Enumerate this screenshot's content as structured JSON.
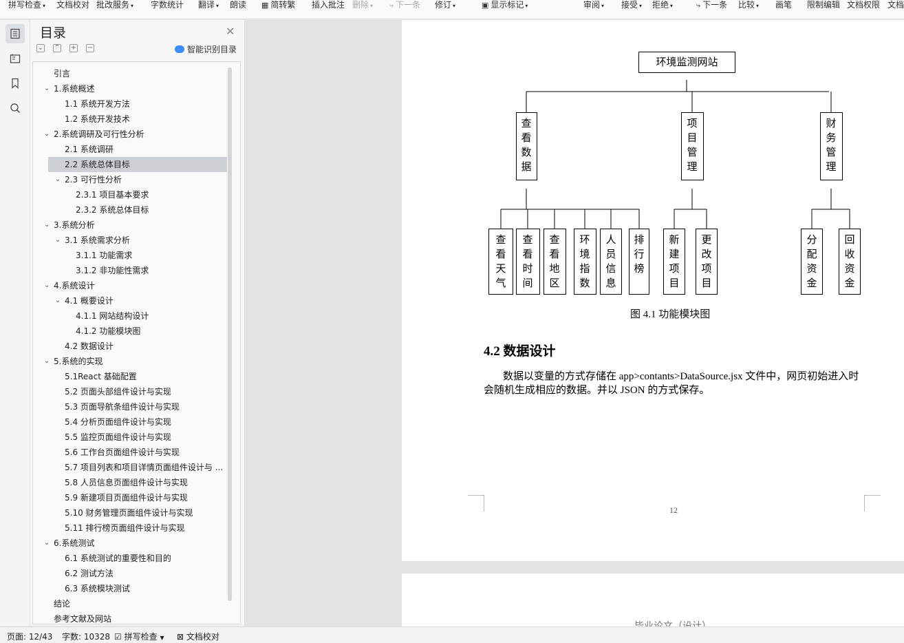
{
  "toolbar": {
    "items": [
      {
        "label": "拼写检查",
        "caret": true
      },
      {
        "label": "文档校对",
        "caret": false
      },
      {
        "label": "批改服务",
        "caret": true
      },
      {
        "label": "字数统计",
        "caret": false
      },
      {
        "label": "翻译",
        "caret": true
      },
      {
        "label": "朗读",
        "caret": false
      },
      {
        "label": "简转繁",
        "caret": false
      },
      {
        "label": "插入批注",
        "caret": false
      },
      {
        "label": "删除",
        "caret": true
      },
      {
        "label": "下一条",
        "caret": false
      },
      {
        "label": "修订",
        "caret": true
      },
      {
        "label": "显示标记",
        "caret": true
      },
      {
        "label": "审阅",
        "caret": true
      },
      {
        "label": "接受",
        "caret": true
      },
      {
        "label": "拒绝",
        "caret": true
      },
      {
        "label": "下一条",
        "caret": false
      },
      {
        "label": "比较",
        "caret": true
      },
      {
        "label": "画笔",
        "caret": false
      },
      {
        "label": "限制编辑",
        "caret": false
      },
      {
        "label": "文档权限",
        "caret": false
      },
      {
        "label": "文档",
        "caret": false
      }
    ]
  },
  "toc": {
    "title": "目录",
    "ai_label": "智能识别目录",
    "controls": [
      "⌄",
      "⌃",
      "+",
      "−"
    ],
    "items": [
      {
        "label": "引言",
        "level": 0,
        "chev": false
      },
      {
        "label": "1.系统概述",
        "level": 0,
        "chev": true
      },
      {
        "label": "1.1  系统开发方法",
        "level": 1,
        "chev": false
      },
      {
        "label": "1.2  系统开发技术",
        "level": 1,
        "chev": false
      },
      {
        "label": "2.系统调研及可行性分析",
        "level": 0,
        "chev": true
      },
      {
        "label": "2.1 系统调研",
        "level": 1,
        "chev": false
      },
      {
        "label": "2.2 系统总体目标",
        "level": 1,
        "chev": false,
        "selected": true
      },
      {
        "label": "2.3 可行性分析",
        "level": 1,
        "chev": true
      },
      {
        "label": "2.3.1 项目基本要求",
        "level": 2,
        "chev": false
      },
      {
        "label": "2.3.2 系统总体目标",
        "level": 2,
        "chev": false
      },
      {
        "label": "3.系统分析",
        "level": 0,
        "chev": true
      },
      {
        "label": "3.1 系统需求分析",
        "level": 1,
        "chev": true
      },
      {
        "label": "3.1.1 功能需求",
        "level": 2,
        "chev": false
      },
      {
        "label": "3.1.2 非功能性需求",
        "level": 2,
        "chev": false
      },
      {
        "label": "4.系统设计",
        "level": 0,
        "chev": true
      },
      {
        "label": "4.1 概要设计",
        "level": 1,
        "chev": true
      },
      {
        "label": "4.1.1 网站结构设计",
        "level": 2,
        "chev": false
      },
      {
        "label": "4.1.2 功能模块图",
        "level": 2,
        "chev": false
      },
      {
        "label": "4.2 数据设计",
        "level": 1,
        "chev": false
      },
      {
        "label": "5.系统的实现",
        "level": 0,
        "chev": true
      },
      {
        "label": "5.1React 基础配置",
        "level": 1,
        "chev": false
      },
      {
        "label": "5.2 页面头部组件设计与实现",
        "level": 1,
        "chev": false
      },
      {
        "label": "5.3 页面导航条组件设计与实现",
        "level": 1,
        "chev": false
      },
      {
        "label": "5.4 分析页面组件设计与实现",
        "level": 1,
        "chev": false
      },
      {
        "label": "5.5 监控页面组件设计与实现",
        "level": 1,
        "chev": false
      },
      {
        "label": "5.6 工作台页面组件设计与实现",
        "level": 1,
        "chev": false
      },
      {
        "label": "5.7 项目列表和项目详情页面组件设计与 ...",
        "level": 1,
        "chev": false
      },
      {
        "label": "5.8 人员信息页面组件设计与实现",
        "level": 1,
        "chev": false
      },
      {
        "label": "5.9 新建项目页面组件设计与实现",
        "level": 1,
        "chev": false
      },
      {
        "label": "5.10 财务管理页面组件设计与实现",
        "level": 1,
        "chev": false
      },
      {
        "label": "5.11 排行榜页面组件设计与实现",
        "level": 1,
        "chev": false
      },
      {
        "label": "6.系统测试",
        "level": 0,
        "chev": true
      },
      {
        "label": "6.1 系统测试的重要性和目的",
        "level": 1,
        "chev": false
      },
      {
        "label": "6.2 测试方法",
        "level": 1,
        "chev": false
      },
      {
        "label": "6.3 系统模块测试",
        "level": 1,
        "chev": false
      },
      {
        "label": "结论",
        "level": 0,
        "chev": false
      },
      {
        "label": "参考文献及网站",
        "level": 0,
        "chev": false
      }
    ]
  },
  "diagram": {
    "root": "环境监测网站",
    "groups": [
      {
        "name": "查看数据",
        "children": [
          "查看天气",
          "查看时间",
          "查看地区",
          "环境指数",
          "人员信息",
          "排行榜"
        ]
      },
      {
        "name": "项目管理",
        "children": [
          "新建项目",
          "更改项目"
        ]
      },
      {
        "name": "财务管理",
        "children": [
          "分配资金",
          "回收资金"
        ]
      }
    ]
  },
  "document": {
    "caption": "图 4.1  功能模块图",
    "section_title": "4.2 数据设计",
    "paragraph": "数据以变量的方式存储在 app>contants>DataSource.jsx 文件中，网页初始进入时会随机生成相应的数据。并以 JSON 的方式保存。",
    "page_number": "12",
    "page2_header": "毕业论文（设计）"
  },
  "status": {
    "page": "页面: 12/43",
    "words": "字数: 10328",
    "spell": "拼写检查",
    "proof": "文档校对"
  }
}
